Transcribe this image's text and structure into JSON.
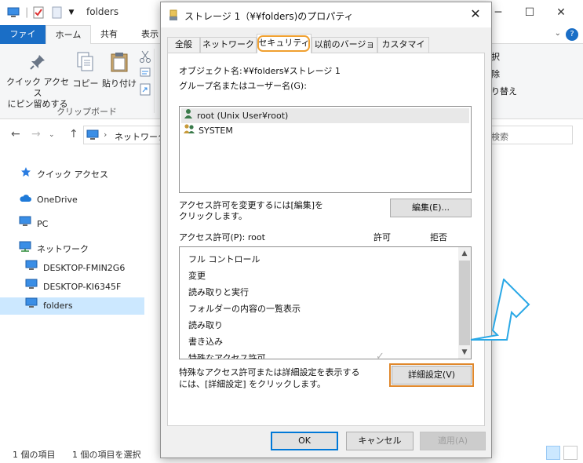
{
  "explorer": {
    "window_title": "folders",
    "ribbon_tabs": {
      "file": "ファイル",
      "home": "ホーム",
      "share": "共有",
      "view": "表示"
    },
    "help": "?",
    "ribbon": {
      "pin_label_1": "クイック アクセス",
      "pin_label_2": "にピン留めする",
      "copy_label": "コピー",
      "paste_label": "貼り付け",
      "clipboard_group": "クリップボード",
      "right_1": "択",
      "right_2": "除",
      "right_3": "り替え"
    },
    "address": {
      "path": "ネットワーク",
      "separator": "›",
      "search_placeholder": "検索"
    },
    "nav": {
      "quick_access": "クイック アクセス",
      "onedrive": "OneDrive",
      "pc": "PC",
      "network": "ネットワーク",
      "desktop1": "DESKTOP-FMIN2G6",
      "desktop2": "DESKTOP-KI6345F",
      "folders": "folders"
    },
    "status": {
      "item_count": "1 個の項目",
      "selected_count": "1 個の項目を選択"
    }
  },
  "dialog": {
    "title": "ストレージ 1（¥¥folders)のプロパティ",
    "close": "✕",
    "tabs": [
      "全般",
      "ネットワーク",
      "セキュリティ",
      "以前のバージョン",
      "カスタマイズ"
    ],
    "object_label": "オブジェクト名:",
    "object_value": "¥¥folders¥ストレージ 1",
    "group_label": "グループ名またはユーザー名(G):",
    "users": [
      "root (Unix User¥root)",
      "SYSTEM"
    ],
    "change_hint_1": "アクセス許可を変更するには[編集]を",
    "change_hint_2": "クリックします。",
    "edit_button": "編集(E)...",
    "perm_label": "アクセス許可(P): root",
    "allow_header": "許可",
    "deny_header": "拒否",
    "permissions": [
      "フル コントロール",
      "変更",
      "読み取りと実行",
      "フォルダーの内容の一覧表示",
      "読み取り",
      "書き込み",
      "特殊なアクセス許可"
    ],
    "special_hint_1": "特殊なアクセス許可または詳細設定を表示する",
    "special_hint_2": "には、[詳細設定] をクリックします。",
    "advanced_button": "詳細設定(V)",
    "ok_button": "OK",
    "cancel_button": "キャンセル",
    "apply_button": "適用(A)"
  },
  "colors": {
    "accent_blue": "#1a6ec6",
    "highlight_orange": "#e0882c",
    "arrow_cyan": "#2aa8e6",
    "selection": "#cce8ff"
  }
}
